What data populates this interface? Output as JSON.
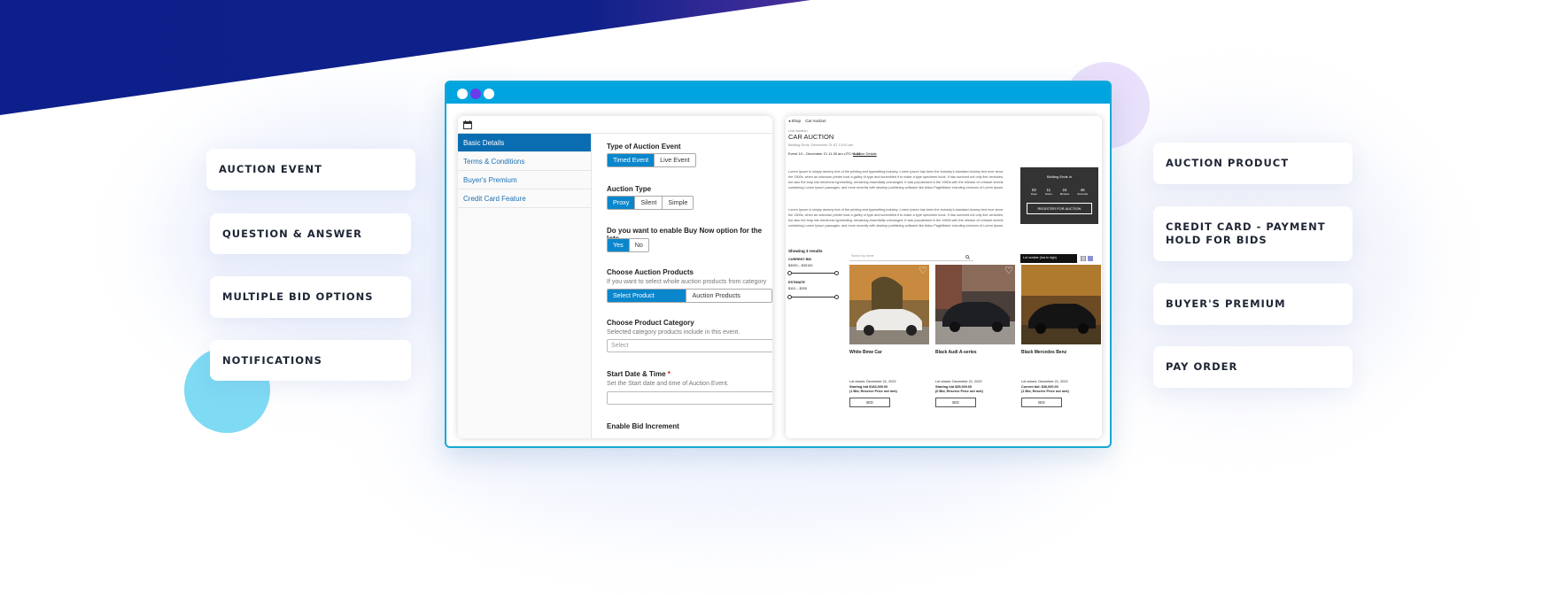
{
  "features_left": [
    "AUCTION EVENT",
    "QUESTION & ANSWER",
    "MULTIPLE BID OPTIONS",
    "NOTIFICATIONS"
  ],
  "features_right": [
    "AUCTION PRODUCT",
    "CREDIT CARD - PAYMENT HOLD FOR BIDS",
    "BUYER'S PREMIUM",
    "PAY ORDER"
  ],
  "colors": {
    "header_navy": "#0d1f8a",
    "window_blue": "#00a5e0",
    "active_blue": "#0a6db1",
    "button_blue": "#0a86cc"
  },
  "admin": {
    "calendar_icon": "calendar-icon",
    "menu": [
      "Basic Details",
      "Terms & Conditions",
      "Buyer's Premium",
      "Credit Card Feature"
    ],
    "type_label": "Type of Auction Event",
    "type_options": [
      "Timed Event",
      "Live Event"
    ],
    "auction_type_label": "Auction Type",
    "auction_type_options": [
      "Proxy",
      "Silent",
      "Simple"
    ],
    "buy_now_label": "Do you want to enable Buy Now option for the lots",
    "buy_now_options": [
      "Yes",
      "No"
    ],
    "products_label": "Choose Auction Products",
    "products_help": "If you want to select whole auction products from category",
    "products_options": [
      "Select Product Category",
      "Auction Products Manually"
    ],
    "category_label": "Choose Product Category",
    "category_help": "Selected category products include in this event.",
    "category_placeholder": "Select",
    "start_label": "Start Date & Time",
    "start_req": "*",
    "start_help": "Set the Start date and time of Auction Event.",
    "increment_label": "Enable Bid Increment"
  },
  "front": {
    "breadcrumb_back": "◂ Shop",
    "breadcrumb_current": "Car Auction",
    "small_label": "Live Auction",
    "title": "CAR AUCTION",
    "bidding_ends": "Bidding Ends: December 21 AT 13:00 am",
    "dates": "Event 19 – December 21 11:30 am UTC+5:30",
    "details_link": "Auction Details",
    "lorem": "Lorem Ipsum is simply dummy text of the printing and typesetting industry. Lorem Ipsum has been the industry's standard dummy text ever since the 1500s, when an unknown printer took a galley of type and scrambled it to make a type specimen book. It has survived not only five centuries, but also the leap into electronic typesetting, remaining essentially unchanged. It was popularised in the 1960s with the release of Letraset sheets containing Lorem Ipsum passages, and more recently with desktop publishing software like Aldus PageMaker including versions of Lorem Ipsum.",
    "countdown_title": "Bidding Ends In",
    "countdown": [
      {
        "v": "02",
        "u": "Days"
      },
      {
        "v": "11",
        "u": "Hours"
      },
      {
        "v": "24",
        "u": "Minutes"
      },
      {
        "v": "45",
        "u": "Seconds"
      }
    ],
    "register_btn": "REGISTER FOR AUCTION",
    "showing": "Showing 3 results",
    "current_bid_label": "CURRENT BID",
    "current_bid_range": "$3000 – $30150",
    "estimate_label": "ESTIMATE",
    "estimate_range": "$101 – $200",
    "search_placeholder": "Search by name",
    "sort_label": "Lot number (low to high)",
    "cars": [
      {
        "name": "White Bmw Car",
        "close": "Lot closes: December 21, 2022",
        "bid": "Starting bid $183,000.00",
        "reserve": "(1 Bid, Reserve Price not met)",
        "btn": "BID"
      },
      {
        "name": "Black Audi A-series",
        "close": "Lot closes: December 21, 2022",
        "bid": "Starting bid $35,000.00",
        "reserve": "(0 Bid, Reserve Price not met)",
        "btn": "BID"
      },
      {
        "name": "Black Mercedes Benz",
        "close": "Lot closes: December 21, 2022",
        "bid": "Current bid: $36,000.00",
        "reserve": "(1 Bid, Reserve Price not met)",
        "btn": "BID"
      }
    ]
  }
}
